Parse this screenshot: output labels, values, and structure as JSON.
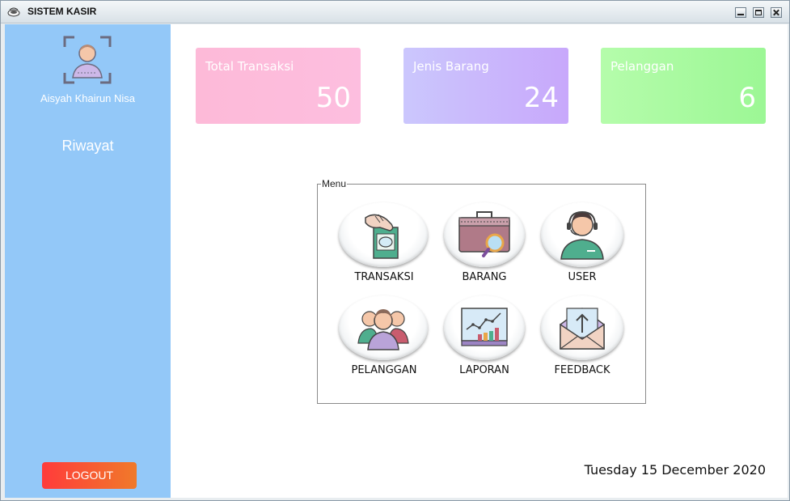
{
  "window": {
    "title": "SISTEM KASIR"
  },
  "sidebar": {
    "user_name": "Aisyah Khairun Nisa",
    "riwayat": "Riwayat",
    "logout": "LOGOUT"
  },
  "cards": [
    {
      "label": "Total Transaksi",
      "value": "50",
      "color": "#fdbad8"
    },
    {
      "label": "Jenis Barang",
      "value": "24",
      "color": "#c8a8fb"
    },
    {
      "label": "Pelanggan",
      "value": "6",
      "color": "#9cf795"
    }
  ],
  "menu": {
    "legend": "Menu",
    "items": [
      {
        "label": "TRANSAKSI",
        "icon": "payment-card-icon"
      },
      {
        "label": "BARANG",
        "icon": "briefcase-search-icon"
      },
      {
        "label": "USER",
        "icon": "headset-user-icon"
      },
      {
        "label": "PELANGGAN",
        "icon": "customers-group-icon"
      },
      {
        "label": "LAPORAN",
        "icon": "report-chart-icon"
      },
      {
        "label": "FEEDBACK",
        "icon": "envelope-upload-icon"
      }
    ]
  },
  "date": "Tuesday 15 December 2020",
  "colors": {
    "sidebar": "#93c8f8",
    "logout": "#ff3b3b"
  }
}
